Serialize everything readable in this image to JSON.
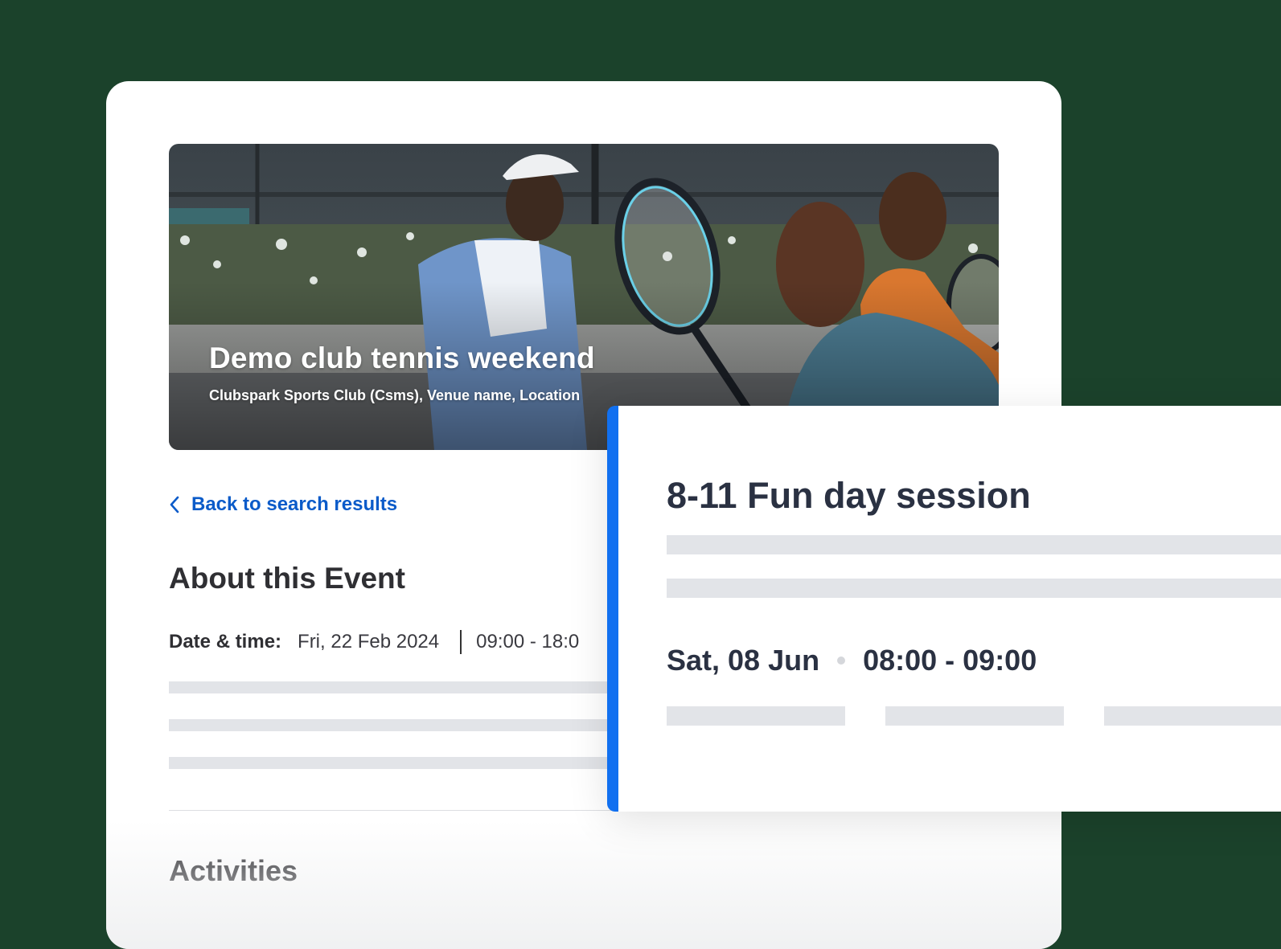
{
  "colors": {
    "background": "#1b422b",
    "card": "#ffffff",
    "link": "#0b5bc9",
    "session_accent": "#1170f0",
    "skeleton": "#e2e4e8"
  },
  "hero": {
    "title": "Demo club tennis weekend",
    "subtitle": "Clubspark Sports Club (Csms), Venue name, Location"
  },
  "nav": {
    "back_icon": "chevron-left-icon",
    "back_label": "Back to search results"
  },
  "about": {
    "heading": "About this Event",
    "date_label": "Date & time:",
    "date_value": "Fri, 22 Feb 2024",
    "time_value": "09:00 - 18:0"
  },
  "activities": {
    "heading": "Activities"
  },
  "session": {
    "title": "8-11 Fun day session",
    "date": "Sat, 08 Jun",
    "time": "08:00 - 09:00"
  }
}
